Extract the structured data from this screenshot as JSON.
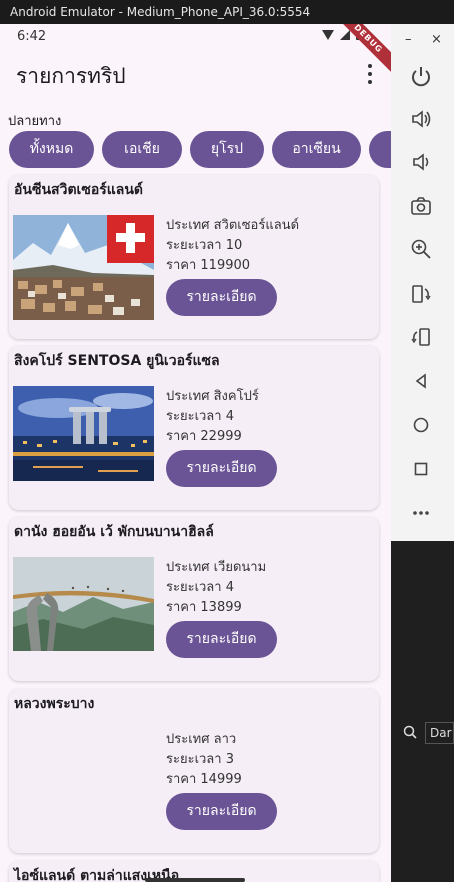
{
  "window": {
    "title": "Android Emulator - Medium_Phone_API_36.0:5554"
  },
  "status_bar": {
    "time": "6:42",
    "debug_label": "DEBUG"
  },
  "app_bar": {
    "title": "รายการทริป"
  },
  "filter": {
    "label": "ปลายทาง",
    "chips": [
      "ทั้งหมด",
      "เอเชีย",
      "ยุโรป",
      "อาเซียน",
      ""
    ]
  },
  "trips": [
    {
      "name": "อันซีนสวิตเซอร์แลนด์",
      "country": "ประเทศ สวิตเซอร์แลนด์",
      "duration": "ระยะเวลา 10",
      "price": "ราคา 119900",
      "button": "รายละเอียด",
      "image": "switzerland-photo"
    },
    {
      "name": "สิงคโปร์ SENTOSA ยูนิเวอร์แซล",
      "country": "ประเทศ สิงคโปร์",
      "duration": "ระยะเวลา 4",
      "price": "ราคา 22999",
      "button": "รายละเอียด",
      "image": "singapore-photo"
    },
    {
      "name": "ดานัง ฮอยอัน เว้ พักบนบานาฮิลล์",
      "country": "ประเทศ เวียดนาม",
      "duration": "ระยะเวลา 4",
      "price": "ราคา 13899",
      "button": "รายละเอียด",
      "image": "vietnam-photo"
    },
    {
      "name": "หลวงพระบาง",
      "country": "ประเทศ ลาว",
      "duration": "ระยะเวลา 3",
      "price": "ราคา 14999",
      "button": "รายละเอียด",
      "image": ""
    },
    {
      "name": "ไอซ์แลนด์ ตามล่าแสงเหนือ"
    }
  ],
  "emulator_panel": {
    "window_controls": [
      "–",
      "×"
    ],
    "buttons": [
      "power-icon",
      "volume-up-icon",
      "volume-down-icon",
      "camera-icon",
      "zoom-icon",
      "rotate-left-icon",
      "rotate-right-icon",
      "back-icon",
      "home-icon",
      "overview-icon",
      "more-icon"
    ]
  },
  "ide": {
    "search_text": "Dar"
  },
  "colors": {
    "accent": "#6a5496",
    "background": "#fbf4fb",
    "card": "#f6eef7"
  }
}
